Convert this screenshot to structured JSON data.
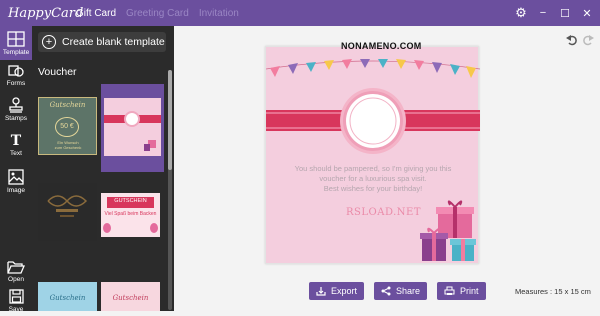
{
  "app": {
    "logo": "HappyCard"
  },
  "tabs": [
    {
      "label": "Gift Card",
      "active": true
    },
    {
      "label": "Greeting Card",
      "active": false
    },
    {
      "label": "Invitation",
      "active": false
    }
  ],
  "window_controls": {
    "settings": "⚙",
    "minimize": "−",
    "maximize": "☐",
    "close": "✕"
  },
  "rail": {
    "template": "Template",
    "forms": "Forms",
    "stamps": "Stamps",
    "text": "Text",
    "image": "Image",
    "open": "Open",
    "save": "Save",
    "text_glyph": "T"
  },
  "panel": {
    "create_label": "Create blank template",
    "section_title": "Voucher",
    "thumbs": {
      "t1_title": "Gutschein",
      "t1_value": "50 €",
      "t1_note": "Ein Wunsch\nzum Geschenk",
      "t4_title": "GUTSCHEIN",
      "t4_sub": "Viel Spaß beim Backen",
      "t5_title": "Gutschein",
      "t6_title": "Gutschein"
    }
  },
  "canvas": {
    "watermark": "NONAMENO.COM",
    "message": [
      "You should be pampered, so I'm giving you this",
      "voucher for a luxurious spa visit.",
      "Best wishes for your birthday!"
    ],
    "brand": "RSLOAD.NET"
  },
  "actions": {
    "export": "Export",
    "share": "Share",
    "print": "Print"
  },
  "measures": "Measures :    15 x 15 cm",
  "colors": {
    "accent": "#6b4f9e",
    "card_bg": "#f4cede",
    "ribbon": "#d8365c",
    "dark": "#2b2b2b"
  }
}
